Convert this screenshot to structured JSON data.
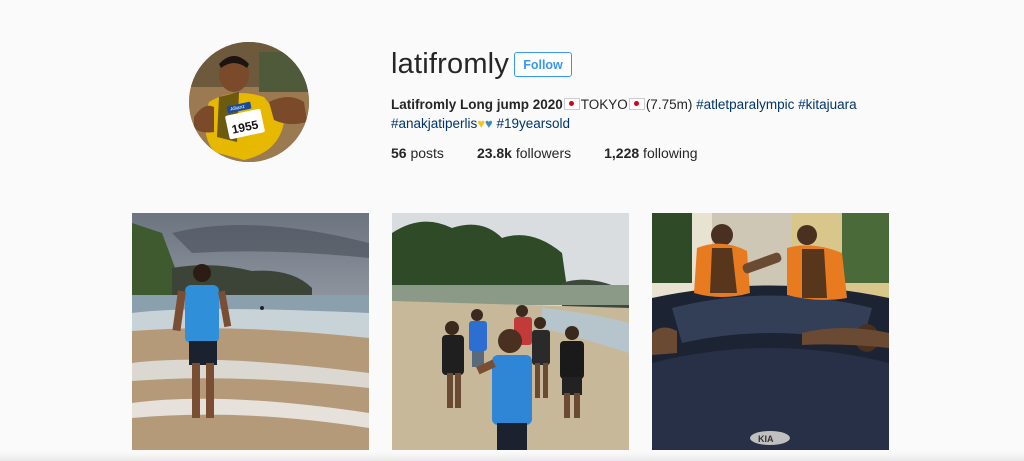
{
  "profile": {
    "username": "latifromly",
    "follow_label": "Follow",
    "bio": {
      "name": "Latifromly",
      "line1_text": " Long jump 2020",
      "tokyo": "TOKYO",
      "result": "(7.75m) ",
      "tags_line1": [
        "#atletparalympic",
        "#kitajuara"
      ],
      "tags_line2": [
        "#anakjatiperlis",
        "#19yearsold"
      ]
    },
    "stats": {
      "posts_count": "56",
      "posts_label": " posts",
      "followers_count": "23.8k",
      "followers_label": " followers",
      "following_count": "1,228",
      "following_label": " following"
    },
    "avatar_bib": "1955",
    "avatar_sponsor": "Allianz"
  },
  "posts": [
    {
      "icon": "beach-walk-photo"
    },
    {
      "icon": "group-selfie-photo"
    },
    {
      "icon": "car-hood-photo"
    }
  ],
  "colors": {
    "accent": "#3897f0",
    "hashtag": "#003569",
    "background": "#fafafa"
  }
}
